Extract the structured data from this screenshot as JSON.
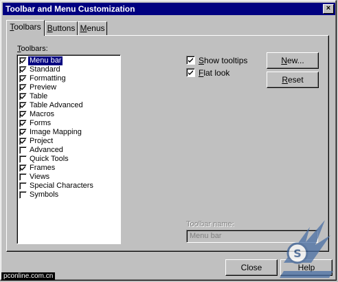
{
  "window": {
    "title": "Toolbar and Menu Customization",
    "close_glyph": "×"
  },
  "tabs": [
    {
      "pre": "",
      "ul": "T",
      "post": "oolbars",
      "active": true
    },
    {
      "pre": "",
      "ul": "B",
      "post": "uttons",
      "active": false
    },
    {
      "pre": "",
      "ul": "M",
      "post": "enus",
      "active": false
    }
  ],
  "list": {
    "label_ul": "T",
    "label_rest": "oolbars:",
    "items": [
      {
        "label": "Menu bar",
        "checked": true,
        "selected": true
      },
      {
        "label": "Standard",
        "checked": true
      },
      {
        "label": "Formatting",
        "checked": true
      },
      {
        "label": "Preview",
        "checked": true
      },
      {
        "label": "Table",
        "checked": true
      },
      {
        "label": "Table Advanced",
        "checked": true
      },
      {
        "label": "Macros",
        "checked": true
      },
      {
        "label": "Forms",
        "checked": true
      },
      {
        "label": "Image Mapping",
        "checked": true
      },
      {
        "label": "Project",
        "checked": true
      },
      {
        "label": "Advanced",
        "checked": false
      },
      {
        "label": "Quick Tools",
        "checked": false
      },
      {
        "label": "Frames",
        "checked": true
      },
      {
        "label": "Views",
        "checked": false
      },
      {
        "label": "Special Characters",
        "checked": false
      },
      {
        "label": "Symbols",
        "checked": false
      }
    ]
  },
  "options": {
    "show_tooltips": {
      "pre": "",
      "ul": "S",
      "post": "how tooltips",
      "checked": true
    },
    "flat_look": {
      "pre": "",
      "ul": "F",
      "post": "lat look",
      "checked": true
    }
  },
  "buttons": {
    "new": {
      "ul": "N",
      "post": "ew..."
    },
    "reset": {
      "ul": "R",
      "post": "eset"
    },
    "close": "Close",
    "help": "Help"
  },
  "toolbar_name": {
    "label": "Toolbar name:",
    "value": "Menu bar"
  },
  "watermark": {
    "source": "pconline.com.cn"
  }
}
